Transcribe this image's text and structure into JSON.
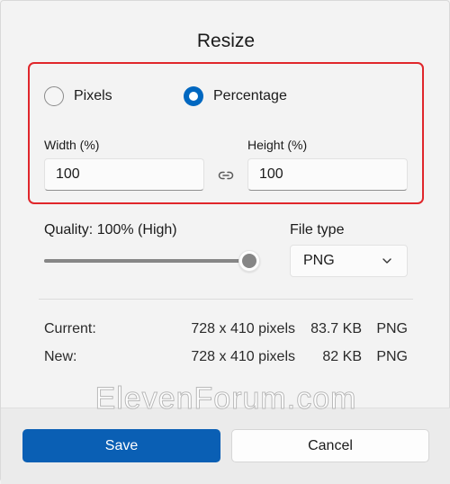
{
  "dialog": {
    "title": "Resize"
  },
  "mode": {
    "options": [
      {
        "label": "Pixels",
        "selected": false
      },
      {
        "label": "Percentage",
        "selected": true
      }
    ]
  },
  "width": {
    "label": "Width  (%)",
    "value": "100"
  },
  "height": {
    "label": "Height  (%)",
    "value": "100"
  },
  "quality": {
    "label": "Quality: 100% (High)",
    "level_percent": 100
  },
  "file_type": {
    "label": "File type",
    "value": "PNG"
  },
  "current": {
    "label": "Current:",
    "dimensions": "728 x 410 pixels",
    "size": "83.7 KB",
    "format": "PNG"
  },
  "new": {
    "label": "New:",
    "dimensions": "728 x 410 pixels",
    "size": "82 KB",
    "format": "PNG"
  },
  "buttons": {
    "save": "Save",
    "cancel": "Cancel"
  },
  "watermark": "ElevenForum.com",
  "colors": {
    "accent": "#0067c0",
    "save_button": "#0a5fb4",
    "highlight_border": "#e0262b"
  },
  "icons": {
    "link": "link-icon",
    "dropdown": "chevron-down-icon"
  }
}
